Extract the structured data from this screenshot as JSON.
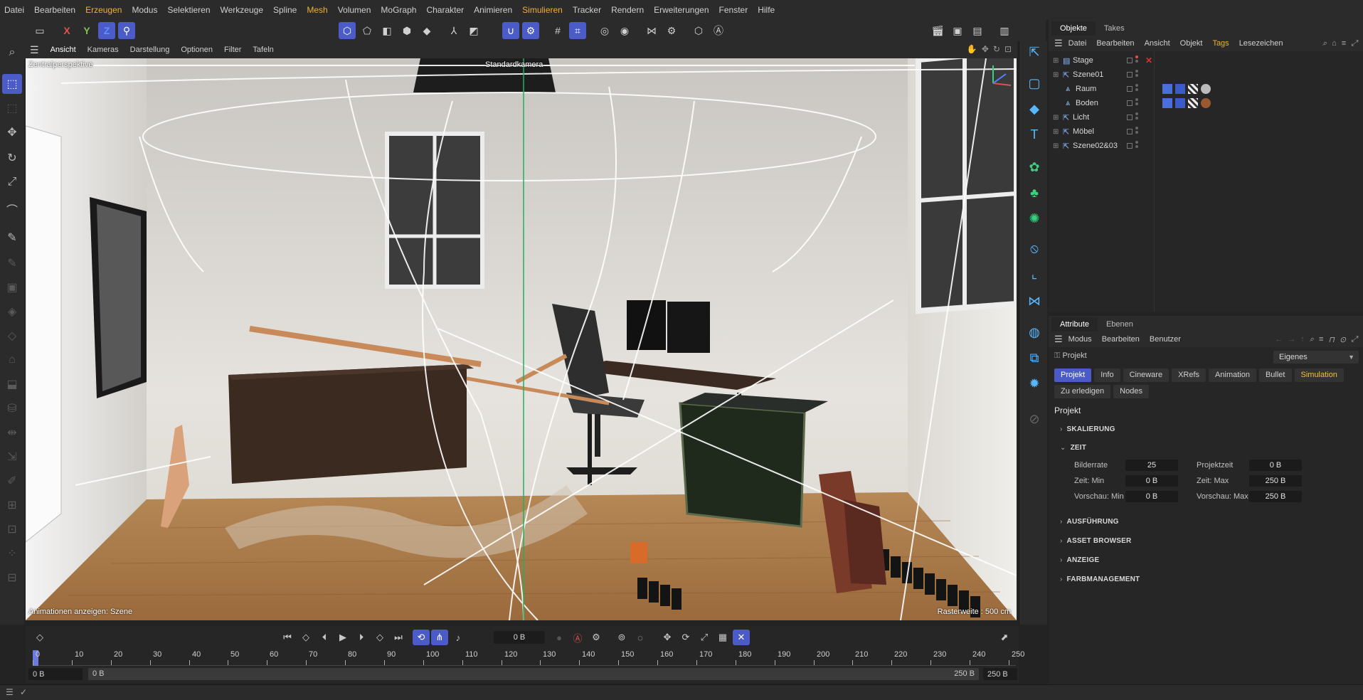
{
  "menu": [
    "Datei",
    "Bearbeiten",
    "Erzeugen",
    "Modus",
    "Selektieren",
    "Werkzeuge",
    "Spline",
    "Mesh",
    "Volumen",
    "MoGraph",
    "Charakter",
    "Animieren",
    "Simulieren",
    "Tracker",
    "Rendern",
    "Erweiterungen",
    "Fenster",
    "Hilfe"
  ],
  "menu_highlighted": [
    "Erzeugen",
    "Mesh",
    "Simulieren"
  ],
  "toolbar": {
    "axis_x": "X",
    "axis_y": "Y",
    "axis_z": "Z"
  },
  "viewport": {
    "menu": [
      "Ansicht",
      "Kameras",
      "Darstellung",
      "Optionen",
      "Filter",
      "Tafeln"
    ],
    "projection": "Zentralperspektive",
    "camera": "Standardkamera",
    "status_left": "Animationen anzeigen: Szene",
    "grid": "Rasterweite : 500 cm"
  },
  "timeline": {
    "current_frame": "0 B",
    "ticks": [
      "0",
      "10",
      "20",
      "30",
      "40",
      "50",
      "60",
      "70",
      "80",
      "90",
      "100",
      "110",
      "120",
      "130",
      "140",
      "150",
      "160",
      "170",
      "180",
      "190",
      "200",
      "210",
      "220",
      "230",
      "240",
      "250"
    ],
    "range_start": "0 B",
    "range_inner_start": "0 B",
    "range_inner_end": "250 B",
    "range_end": "250 B"
  },
  "objects": {
    "tabs": [
      "Objekte",
      "Takes"
    ],
    "menu": [
      "Datei",
      "Bearbeiten",
      "Ansicht",
      "Objekt",
      "Tags",
      "Lesezeichen"
    ],
    "items": [
      {
        "name": "Stage",
        "icon": "stage-icon"
      },
      {
        "name": "Szene01",
        "icon": "null-icon"
      },
      {
        "name": "Raum",
        "icon": "polygon-icon"
      },
      {
        "name": "Boden",
        "icon": "polygon-icon"
      },
      {
        "name": "Licht",
        "icon": "null-icon"
      },
      {
        "name": "Möbel",
        "icon": "null-icon"
      },
      {
        "name": "Szene02&03",
        "icon": "null-icon"
      }
    ]
  },
  "attributes": {
    "tabs": [
      "Attribute",
      "Ebenen"
    ],
    "menu": [
      "Modus",
      "Bearbeiten",
      "Benutzer"
    ],
    "object_label": "Projekt",
    "mode_dropdown": "Eigenes",
    "subtabs": [
      "Projekt",
      "Info",
      "Cineware",
      "XRefs",
      "Animation",
      "Bullet",
      "Simulation",
      "Zu erledigen",
      "Nodes"
    ],
    "heading": "Projekt",
    "sections": [
      "SKALIERUNG",
      "ZEIT",
      "AUSFÜHRUNG",
      "ASSET BROWSER",
      "ANZEIGE",
      "FARBMANAGEMENT"
    ],
    "fields": {
      "bilderrate_label": "Bilderrate",
      "bilderrate": "25",
      "projektzeit_label": "Projektzeit",
      "projektzeit": "0 B",
      "zeit_min_label": "Zeit: Min",
      "zeit_min": "0 B",
      "zeit_max_label": "Zeit: Max",
      "zeit_max": "250 B",
      "vorschau_min_label": "Vorschau: Min",
      "vorschau_min": "0 B",
      "vorschau_max_label": "Vorschau: Max",
      "vorschau_max": "250 B"
    }
  },
  "colors": {
    "accent": "#4b5bc8",
    "highlight_text": "#f0b030",
    "close": "#e03030"
  }
}
